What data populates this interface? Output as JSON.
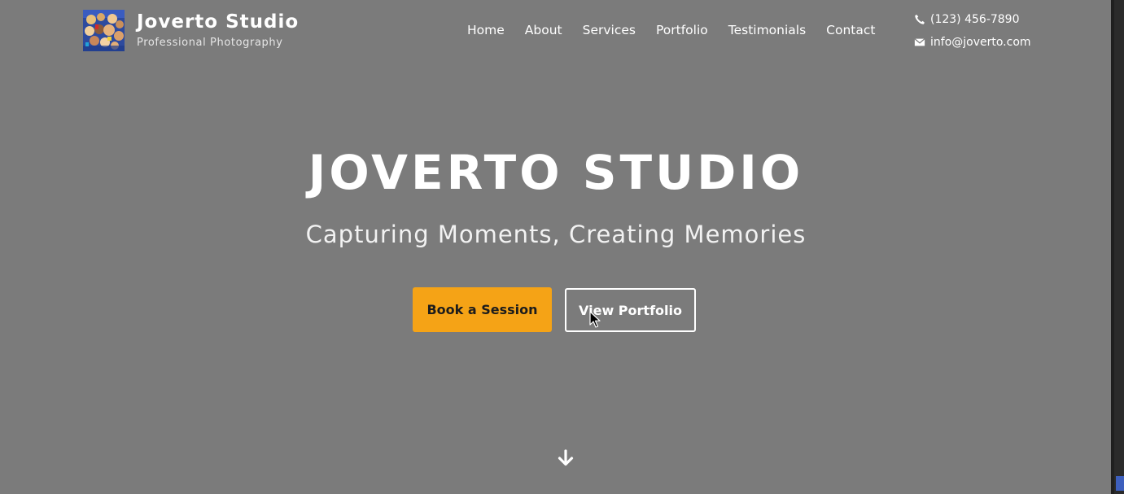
{
  "brand": {
    "title": "Joverto Studio",
    "subtitle": "Professional Photography",
    "logo_icon": "group-photo-logo"
  },
  "nav": {
    "items": [
      {
        "label": "Home"
      },
      {
        "label": "About"
      },
      {
        "label": "Services"
      },
      {
        "label": "Portfolio"
      },
      {
        "label": "Testimonials"
      },
      {
        "label": "Contact"
      }
    ]
  },
  "contact": {
    "phone": "(123) 456-7890",
    "phone_icon": "phone-icon",
    "email": "info@joverto.com",
    "email_icon": "envelope-icon"
  },
  "hero": {
    "title": "JOVERTO STUDIO",
    "subtitle": "Capturing Moments, Creating Memories",
    "primary_button": "Book a Session",
    "secondary_button": "View Portfolio",
    "scroll_icon": "arrow-down-icon"
  },
  "colors": {
    "background": "#7b7b7b",
    "accent": "#f5a316",
    "text": "#ffffff",
    "scrollbar_thumb": "#3d5fbd"
  }
}
